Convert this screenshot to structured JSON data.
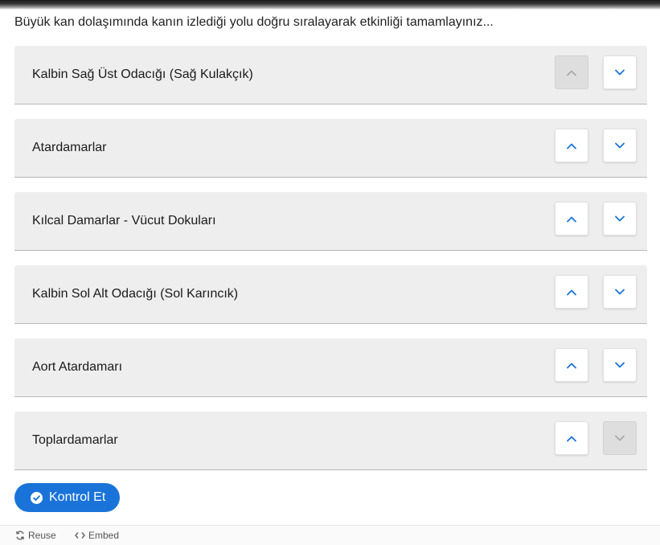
{
  "instruction": "Büyük kan dolaşımında kanın izlediği yolu doğru sıralayarak etkinliği tamamlayınız...",
  "items": [
    {
      "label": "Kalbin Sağ Üst Odacığı (Sağ Kulakçık)",
      "up_enabled": false,
      "down_enabled": true
    },
    {
      "label": "Atardamarlar",
      "up_enabled": true,
      "down_enabled": true
    },
    {
      "label": "Kılcal Damarlar - Vücut Dokuları",
      "up_enabled": true,
      "down_enabled": true
    },
    {
      "label": "Kalbin Sol Alt Odacığı (Sol Karıncık)",
      "up_enabled": true,
      "down_enabled": true
    },
    {
      "label": "Aort Atardamarı",
      "up_enabled": true,
      "down_enabled": true
    },
    {
      "label": "Toplardamarlar",
      "up_enabled": true,
      "down_enabled": false
    }
  ],
  "check_button": {
    "label": "Kontrol Et",
    "icon": "check-circle-icon"
  },
  "footer": {
    "reuse_label": "Reuse",
    "reuse_icon": "reuse-icon",
    "embed_label": "Embed",
    "embed_icon": "embed-icon"
  },
  "colors": {
    "accent": "#1a73d9",
    "item_background": "#eeeeee",
    "disabled_button": "#dedede"
  }
}
